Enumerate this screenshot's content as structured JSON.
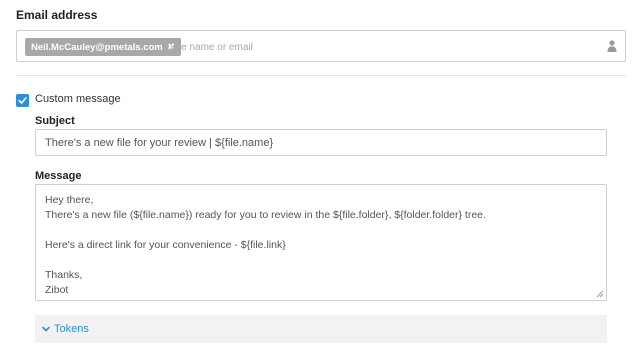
{
  "email": {
    "label": "Email address",
    "chip": "Neil.McCauley@pmetals.com",
    "chip_remove": "✖",
    "placeholder": "Type name or email"
  },
  "custom_message": {
    "checked": true,
    "label": "Custom message"
  },
  "subject": {
    "label": "Subject",
    "value": "There's a new file for your review |  ${file.name}"
  },
  "message": {
    "label": "Message",
    "lines": [
      "Hey there,",
      "There's a new file (${file.name}) ready for you to review in the ${file.folder}, ${folder.folder} tree.",
      "",
      "Here's a direct link for your convenience - ${file.link}",
      "",
      "Thanks,",
      "Zibot"
    ]
  },
  "tokens": {
    "label": "Tokens"
  },
  "colors": {
    "accent": "#2b91d6",
    "chip_bg": "#a8a8a8",
    "border": "#cfcfcf"
  }
}
